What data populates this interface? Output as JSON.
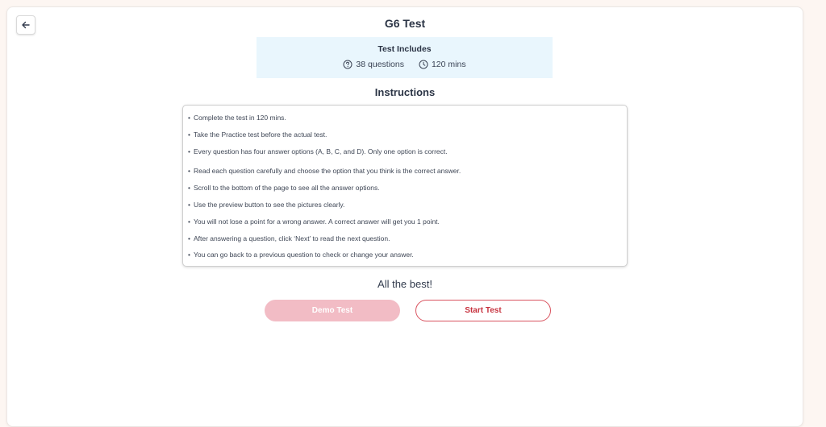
{
  "header": {
    "title": "G6 Test",
    "back_icon": "arrow-left-icon"
  },
  "test_includes": {
    "title": "Test Includes",
    "questions": "38 questions",
    "duration": "120 mins"
  },
  "instructions": {
    "heading": "Instructions",
    "items": [
      "Complete the test in 120 mins.",
      "Take the Practice test before the actual test.",
      "Every question has four answer options (A, B, C, and D). Only one option is correct.",
      "Read each question carefully and choose the option that you think is the correct answer.",
      "Scroll to the bottom of the page to see all the answer options.",
      "Use the preview button to see the pictures clearly.",
      "You will not lose a point for a wrong answer. A correct answer will get you 1 point.",
      "After answering a question, click ‘Next’ to read the next question.",
      "You can go back to a previous question to check or change your answer."
    ]
  },
  "footer": {
    "message": "All the best!",
    "demo_label": "Demo Test",
    "start_label": "Start Test"
  },
  "colors": {
    "page_bg": "#fdf6f2",
    "info_bg": "#e9f6fd",
    "demo_bg": "#f2bcc5",
    "start_text": "#c7333f"
  }
}
